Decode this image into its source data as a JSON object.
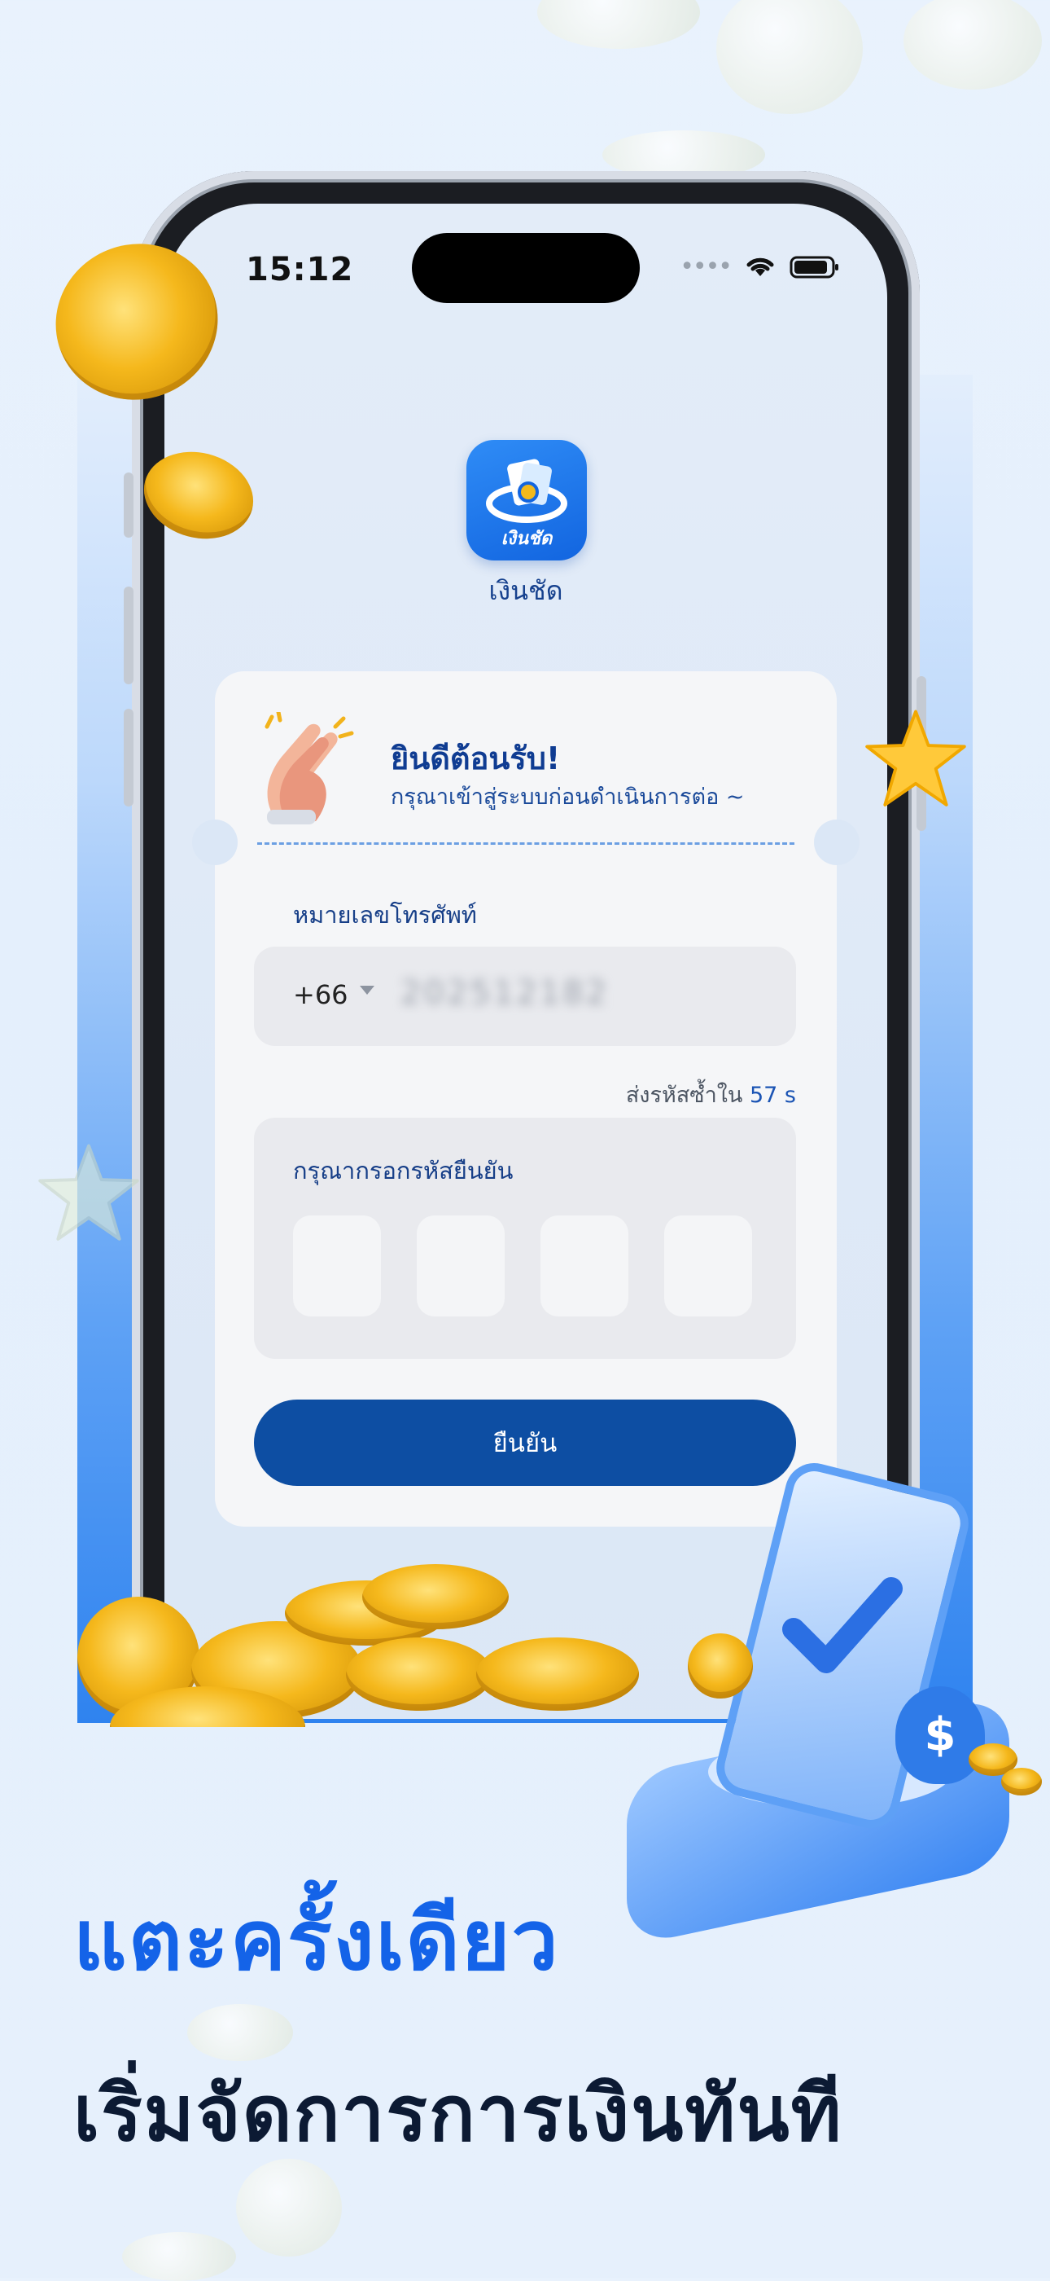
{
  "status_bar": {
    "time": "15:12"
  },
  "app": {
    "icon_text": "เงินชัด",
    "name": "เงินชัด"
  },
  "welcome": {
    "title": "ยินดีต้อนรับ!",
    "subtitle": "กรุณาเข้าสู่ระบบก่อนดำเนินการต่อ ~"
  },
  "phone_field": {
    "label": "หมายเลขโทรศัพท์",
    "country_code": "+66",
    "number": "202512182"
  },
  "resend": {
    "text": "ส่งรหัสซ้ำใน",
    "countdown": "57 s"
  },
  "verification": {
    "label": "กรุณากรอกรหัสยืนยัน"
  },
  "confirm_button": {
    "label": "ยืนยัน"
  },
  "headline": {
    "line1": "แตะครั้งเดียว",
    "line2": "เริ่มจัดการการเงินทันที"
  },
  "colors": {
    "primary": "#0d4ea3",
    "accent": "#1463e8",
    "title": "#0f3c92"
  }
}
